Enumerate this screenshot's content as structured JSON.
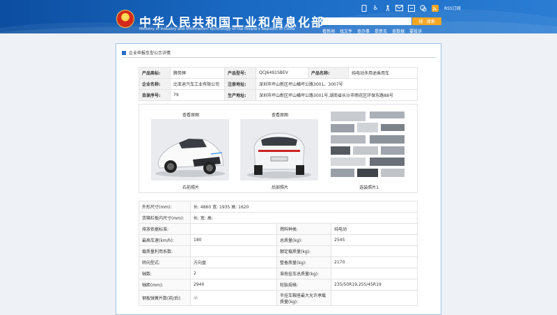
{
  "header": {
    "title": "中华人民共和国工业和信息化部",
    "subtitle": "Ministry of Industry and Information Technology of the People's Republic of China",
    "search_button": "搜 · 搜索",
    "rss_label": "RSS订阅",
    "nav": [
      "看新闻",
      "找文件",
      "查办事",
      "提意见",
      "查数据",
      "要投诉"
    ]
  },
  "panel": {
    "title": "企业申报车型公示详情"
  },
  "info": {
    "brand_label": "产品商标:",
    "brand_value": "腾势牌",
    "model_label": "产品型号:",
    "model_value": "QCJ6491SBEV",
    "name_label": "产品名称:",
    "name_value": "纯电动多用途乘用车",
    "company_label": "企业名称:",
    "company_value": "比亚迪汽车工业有限公司",
    "reg_label": "注册地址:",
    "reg_value": "深圳市坪山新区坪山横坪公路3001、3007号",
    "catalog_label": "目录序号:",
    "catalog_value": "79",
    "prod_label": "生产地址:",
    "prod_value": "深圳市坪山新区坪山横坪公路3001号,湖南省长沙市雨花区环保东路88号"
  },
  "photos": {
    "view_label": "查看原图",
    "front": "右前照片",
    "rear": "后部照片",
    "optional": "选装照片1"
  },
  "specs": {
    "dims_label": "外形尺寸(mm):",
    "dims_value": "长:  4860 宽:  1935 高:  1620",
    "cargo_label": "货箱栏板内尺寸(mm):",
    "cargo_value": "长:    宽:    高:",
    "emission_label": "排放依据标准:",
    "emission_value": "",
    "fuel_label": "燃料种类:",
    "fuel_value": "纯电动",
    "speed_label": "最高车速(km/h):",
    "speed_value": "180",
    "total_mass_label": "总质量(kg):",
    "total_mass_value": "2545",
    "load_util_label": "载质量利用系数:",
    "load_util_value": "",
    "rated_load_label": "额定载质量(kg):",
    "rated_load_value": "",
    "steering_label": "转向型式:",
    "steering_value": "方向盘",
    "curb_mass_label": "整备质量(kg):",
    "curb_mass_value": "2170",
    "axles_label": "轴数:",
    "axles_value": "2",
    "semi_trailer_label": "准拖挂车总质量(kg):",
    "semi_trailer_value": "",
    "wheelbase_label": "轴距(mm):",
    "wheelbase_value": "2940",
    "tire_label": "轮胎规格:",
    "tire_value": "235/50R19,255/45R19",
    "spring_label": "钢板弹簧片数(前/后):",
    "spring_value": "-/-",
    "saddle_label": "半挂车鞍座最大允许承载质量(kg):",
    "saddle_value": ""
  },
  "colors": {
    "header_blue": "#1560b8",
    "search_orange": "#f5a623",
    "panel_border": "#9ec0e4"
  }
}
